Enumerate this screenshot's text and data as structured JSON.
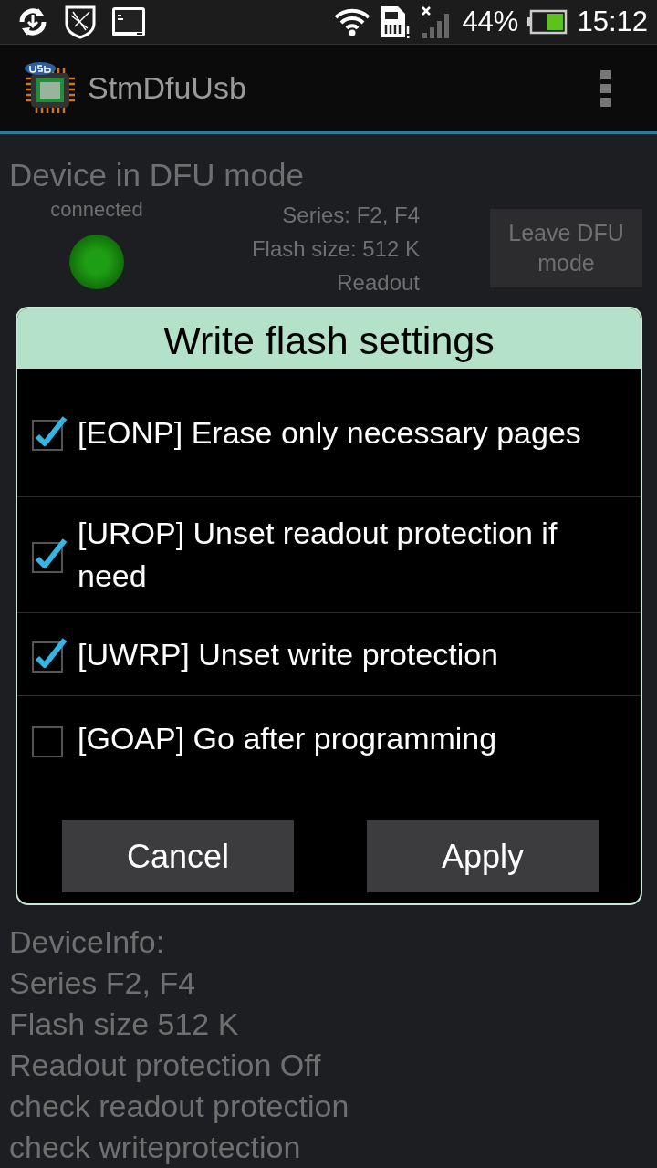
{
  "status_bar": {
    "battery": "44%",
    "time": "15:12"
  },
  "app_bar": {
    "title": "StmDfuUsb"
  },
  "device": {
    "heading": "Device in DFU mode",
    "connection": "connected",
    "led_on": true,
    "info": [
      "Series: F2, F4",
      "Flash size: 512 K",
      "Readout"
    ],
    "leave_button": "Leave DFU mode"
  },
  "log": [
    "DeviceInfo:",
    "Series F2, F4",
    "Flash size 512 K",
    "Readout protection Off",
    "check readout protection",
    "check writeprotection"
  ],
  "dialog": {
    "title": "Write flash settings",
    "options": [
      {
        "label": "[EONP] Erase only necessary pages",
        "checked": true
      },
      {
        "label": "[UROP] Unset readout protection if need",
        "checked": true
      },
      {
        "label": "[UWRP] Unset write protection",
        "checked": true
      },
      {
        "label": "[GOAP] Go after programming",
        "checked": false
      }
    ],
    "buttons": [
      "Cancel",
      "Apply"
    ]
  }
}
